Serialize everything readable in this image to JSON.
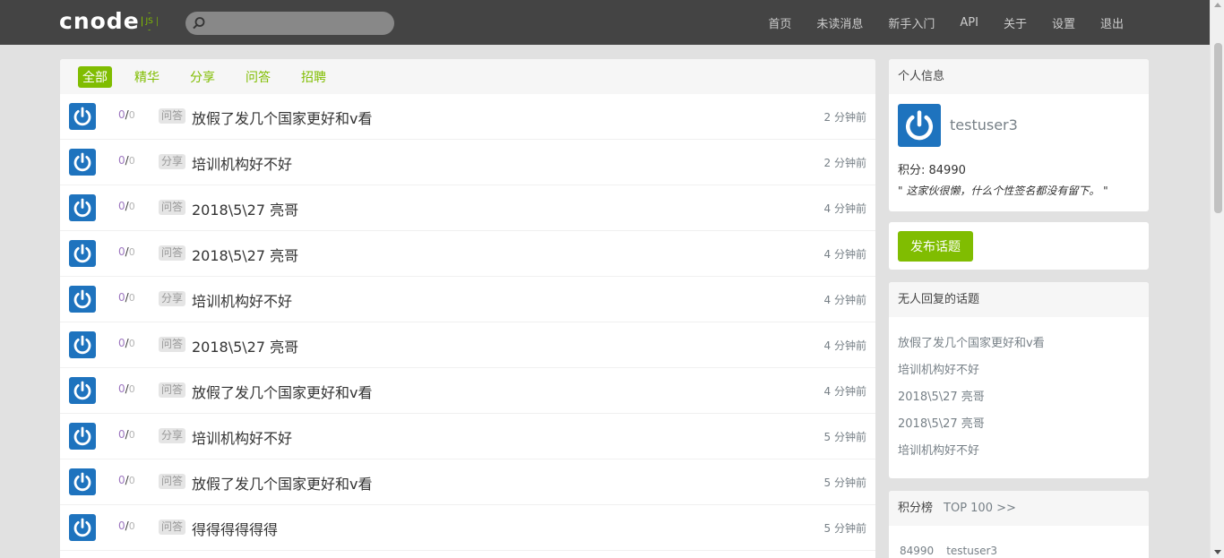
{
  "nav": {
    "logo_text": "cnode",
    "logo_badge": "JS",
    "search_placeholder": "",
    "links": [
      "首页",
      "未读消息",
      "新手入门",
      "API",
      "关于",
      "设置",
      "退出"
    ]
  },
  "tabs": [
    "全部",
    "精华",
    "分享",
    "问答",
    "招聘"
  ],
  "topics": [
    {
      "replies": "0",
      "visits": "0",
      "tag": "问答",
      "title": "放假了发几个国家更好和v看",
      "time": "2 分钟前"
    },
    {
      "replies": "0",
      "visits": "0",
      "tag": "分享",
      "title": "培训机构好不好",
      "time": "2 分钟前"
    },
    {
      "replies": "0",
      "visits": "0",
      "tag": "问答",
      "title": "2018\\5\\27 亮哥",
      "time": "4 分钟前"
    },
    {
      "replies": "0",
      "visits": "0",
      "tag": "问答",
      "title": "2018\\5\\27 亮哥",
      "time": "4 分钟前"
    },
    {
      "replies": "0",
      "visits": "0",
      "tag": "分享",
      "title": "培训机构好不好",
      "time": "4 分钟前"
    },
    {
      "replies": "0",
      "visits": "0",
      "tag": "问答",
      "title": "2018\\5\\27 亮哥",
      "time": "4 分钟前"
    },
    {
      "replies": "0",
      "visits": "0",
      "tag": "问答",
      "title": "放假了发几个国家更好和v看",
      "time": "4 分钟前"
    },
    {
      "replies": "0",
      "visits": "0",
      "tag": "分享",
      "title": "培训机构好不好",
      "time": "5 分钟前"
    },
    {
      "replies": "0",
      "visits": "0",
      "tag": "问答",
      "title": "放假了发几个国家更好和v看",
      "time": "5 分钟前"
    },
    {
      "replies": "0",
      "visits": "0",
      "tag": "问答",
      "title": "得得得得得得",
      "time": "5 分钟前"
    }
  ],
  "profile": {
    "header": "个人信息",
    "username": "testuser3",
    "score": "积分: 84990",
    "signature": "\" 这家伙很懒，什么个性签名都没有留下。 \""
  },
  "post_button": "发布话题",
  "no_reply": {
    "header": "无人回复的话题",
    "items": [
      "放假了发几个国家更好和v看",
      "培训机构好不好",
      "2018\\5\\27 亮哥",
      "2018\\5\\27 亮哥",
      "培训机构好不好"
    ]
  },
  "rank": {
    "header": "积分榜",
    "top_link": "TOP 100 >>",
    "rows": [
      {
        "score": "84990",
        "name": "testuser3"
      }
    ]
  },
  "colors": {
    "accent": "#80bd01",
    "navbar": "#444444",
    "avatar": "#1e73be"
  }
}
